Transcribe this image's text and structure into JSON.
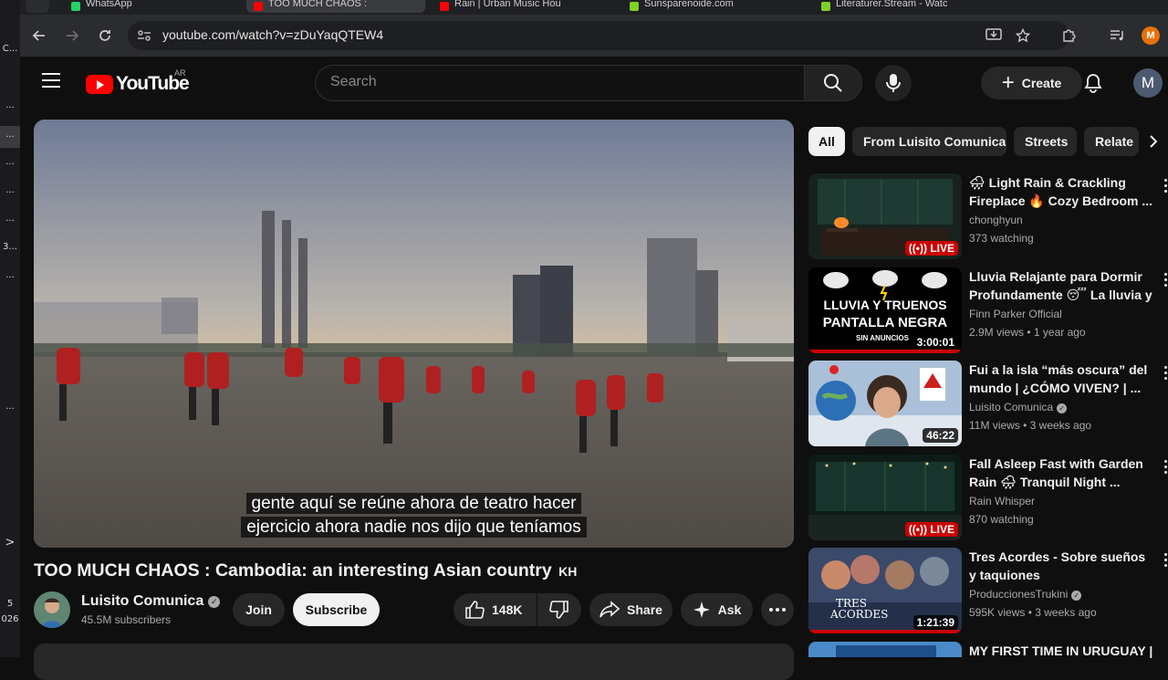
{
  "left_strip": {
    "items": [
      "C...",
      "...",
      "...",
      "...",
      "...",
      "...",
      "3...",
      "...",
      "...",
      ">",
      "5",
      "026"
    ]
  },
  "browser": {
    "tabs": [
      {
        "title": "WhatsApp",
        "color": "#25d366"
      },
      {
        "title": "TOO MUCH CHAOS :",
        "color": "#ff0000"
      },
      {
        "title": "Rain | Urban Music Hou",
        "color": "#ff0000"
      },
      {
        "title": "Sunsparenoide.com",
        "color": "#7cd321"
      },
      {
        "title": "Literaturer.Stream - Watc",
        "color": "#7cd321"
      }
    ],
    "url": "youtube.com/watch?v=zDuYaqQTEW4",
    "profile_initial": "M"
  },
  "header": {
    "logo_text": "YouTube",
    "country_code": "AR",
    "search_placeholder": "Search",
    "create_label": "Create",
    "avatar_initial": "M"
  },
  "player": {
    "caption_line1": "gente aquí se reúne ahora de teatro hacer",
    "caption_line2": "ejercicio ahora nadie nos dijo que teníamos"
  },
  "video": {
    "title": "TOO MUCH CHAOS : Cambodia: an interesting Asian country",
    "title_suffix": "KH",
    "channel": "Luisito Comunica",
    "subscribers": "45.5M subscribers",
    "join_label": "Join",
    "subscribe_label": "Subscribe",
    "likes": "148K",
    "share_label": "Share",
    "ask_label": "Ask"
  },
  "chips": [
    "All",
    "From Luisito Comunica",
    "Streets",
    "Relate"
  ],
  "recommendations": [
    {
      "title": "🌧 Light Rain & Crackling Fireplace 🔥 Cozy Bedroom ...",
      "channel": "chonghyun",
      "verified": false,
      "meta": "373 watching",
      "badge": "((•)) LIVE",
      "live": true
    },
    {
      "title": "Lluvia Relajante para Dormir Profundamente 😴 La lluvia y ...",
      "channel": "Finn Parker Official",
      "verified": false,
      "meta": "2.9M views • 1 year ago",
      "badge": "3:00:01",
      "live": false,
      "thumb_text1": "LLUVIA Y TRUENOS",
      "thumb_text2": "PANTALLA NEGRA",
      "thumb_text3": "SIN ANUNCIOS"
    },
    {
      "title": "Fui a la isla “más oscura” del mundo | ¿CÓMO VIVEN? | ...",
      "channel": "Luisito Comunica",
      "verified": true,
      "meta": "11M views • 3 weeks ago",
      "badge": "46:22",
      "live": false
    },
    {
      "title": "Fall Asleep Fast with Garden Rain 🌧 Tranquil Night ...",
      "channel": "Rain Whisper",
      "verified": false,
      "meta": "870 watching",
      "badge": "((•)) LIVE",
      "live": true
    },
    {
      "title": "Tres Acordes - Sobre sueños y taquiones",
      "channel": "ProduccionesTrukini",
      "verified": true,
      "meta": "595K views • 3 weeks ago",
      "badge": "1:21:39",
      "live": false,
      "thumb_text1": "TRES",
      "thumb_text2": "ACORDES"
    },
    {
      "title": "MY FIRST TIME IN URUGUAY |",
      "channel": "",
      "verified": false,
      "meta": "",
      "badge": "",
      "live": false
    }
  ]
}
